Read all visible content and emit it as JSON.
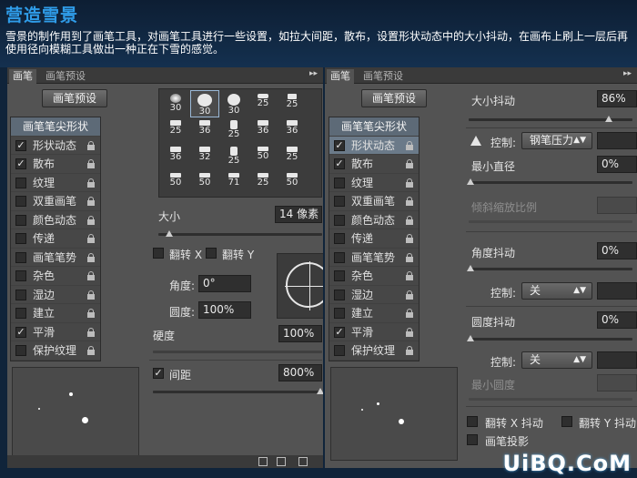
{
  "header": {
    "title": "营造雪景",
    "description": "雪景的制作用到了画笔工具，对画笔工具进行一些设置，如拉大间距，散布，设置形状动态中的大小抖动，在画布上刷上一层后再使用径向模糊工具做出一种正在下雪的感觉。"
  },
  "left_panel": {
    "tabs": [
      "画笔",
      "画笔预设"
    ],
    "preset_button": "画笔预设",
    "options": [
      {
        "label": "画笔笔尖形状",
        "type": "header"
      },
      {
        "label": "形状动态",
        "checked": true
      },
      {
        "label": "散布",
        "checked": true
      },
      {
        "label": "纹理",
        "checked": false
      },
      {
        "label": "双重画笔",
        "checked": false
      },
      {
        "label": "颜色动态",
        "checked": false
      },
      {
        "label": "传递",
        "checked": false
      },
      {
        "label": "画笔笔势",
        "checked": false
      },
      {
        "label": "杂色",
        "checked": false
      },
      {
        "label": "湿边",
        "checked": false
      },
      {
        "label": "建立",
        "checked": false
      },
      {
        "label": "平滑",
        "checked": true
      },
      {
        "label": "保护纹理",
        "checked": false
      }
    ],
    "brush_tips": [
      [
        "30",
        "30",
        "30",
        "25",
        "25"
      ],
      [
        "25",
        "36",
        "25",
        "36",
        "36"
      ],
      [
        "36",
        "32",
        "25",
        "50",
        "25"
      ],
      [
        "50",
        "50",
        "71",
        "25",
        "50"
      ]
    ],
    "size": {
      "label": "大小",
      "value": "14 像素"
    },
    "flip_x": "翻转 X",
    "flip_y": "翻转 Y",
    "angle": {
      "label": "角度:",
      "value": "0°"
    },
    "roundness": {
      "label": "圆度:",
      "value": "100%"
    },
    "hardness": {
      "label": "硬度",
      "value": "100%"
    },
    "spacing": {
      "label": "间距",
      "value": "800%",
      "checked": true
    }
  },
  "right_panel": {
    "tabs": [
      "画笔",
      "画笔预设"
    ],
    "preset_button": "画笔预设",
    "options": [
      {
        "label": "画笔笔尖形状",
        "type": "header"
      },
      {
        "label": "形状动态",
        "checked": true,
        "selected": true
      },
      {
        "label": "散布",
        "checked": true
      },
      {
        "label": "纹理",
        "checked": false
      },
      {
        "label": "双重画笔",
        "checked": false
      },
      {
        "label": "颜色动态",
        "checked": false
      },
      {
        "label": "传递",
        "checked": false
      },
      {
        "label": "画笔笔势",
        "checked": false
      },
      {
        "label": "杂色",
        "checked": false
      },
      {
        "label": "湿边",
        "checked": false
      },
      {
        "label": "建立",
        "checked": false
      },
      {
        "label": "平滑",
        "checked": true
      },
      {
        "label": "保护纹理",
        "checked": false
      }
    ],
    "size_jitter": {
      "label": "大小抖动",
      "value": "86%"
    },
    "control1": {
      "label": "控制:",
      "value": "钢笔压力"
    },
    "min_diameter": {
      "label": "最小直径",
      "value": "0%"
    },
    "tilt_scale": {
      "label": "倾斜缩放比例"
    },
    "angle_jitter": {
      "label": "角度抖动",
      "value": "0%"
    },
    "control2": {
      "label": "控制:",
      "value": "关"
    },
    "roundness_jitter": {
      "label": "圆度抖动",
      "value": "0%"
    },
    "control3": {
      "label": "控制:",
      "value": "关"
    },
    "min_roundness": {
      "label": "最小圆度"
    },
    "flip_x_jitter": "翻转 X 抖动",
    "flip_y_jitter": "翻转 Y 抖动",
    "brush_projection": "画笔投影"
  },
  "watermark": "UiBQ.CoM"
}
